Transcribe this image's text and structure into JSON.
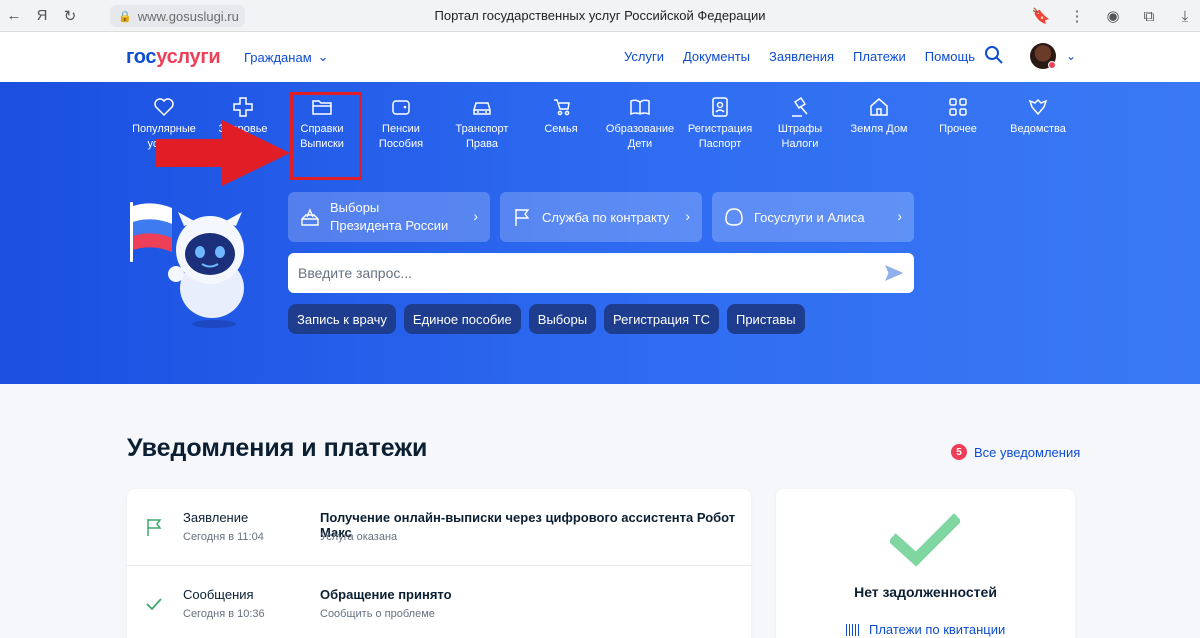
{
  "browser": {
    "url": "www.gosuslugi.ru",
    "tab_title": "Портал государственных услуг Российской Федерации"
  },
  "header": {
    "logo_part1": "гос",
    "logo_part2": "услуги",
    "audience_menu": "Гражданам",
    "nav": [
      "Услуги",
      "Документы",
      "Заявления",
      "Платежи",
      "Помощь"
    ]
  },
  "categories": [
    {
      "line1": "Популярные",
      "line2": "услуги",
      "icon": "heart-icon"
    },
    {
      "line1": "Здоровье",
      "line2": "",
      "icon": "plus-icon"
    },
    {
      "line1": "Справки",
      "line2": "Выписки",
      "icon": "folder-icon"
    },
    {
      "line1": "Пенсии",
      "line2": "Пособия",
      "icon": "wallet-icon"
    },
    {
      "line1": "Транспорт",
      "line2": "Права",
      "icon": "car-icon"
    },
    {
      "line1": "Семья",
      "line2": "",
      "icon": "stroller-icon"
    },
    {
      "line1": "Образование",
      "line2": "Дети",
      "icon": "book-icon"
    },
    {
      "line1": "Регистрация",
      "line2": "Паспорт",
      "icon": "passport-icon"
    },
    {
      "line1": "Штрафы",
      "line2": "Налоги",
      "icon": "gavel-icon"
    },
    {
      "line1": "Земля Дом",
      "line2": "",
      "icon": "house-icon"
    },
    {
      "line1": "Прочее",
      "line2": "",
      "icon": "grid-icon"
    },
    {
      "line1": "Ведомства",
      "line2": "",
      "icon": "emblem-icon"
    }
  ],
  "promos": [
    {
      "line1": "Выборы",
      "line2": "Президента России"
    },
    {
      "label": "Служба по контракту"
    },
    {
      "label": "Госуслуги и Алиса"
    }
  ],
  "search": {
    "placeholder": "Введите запрос..."
  },
  "chips": [
    "Запись к врачу",
    "Единое пособие",
    "Выборы",
    "Регистрация ТС",
    "Приставы"
  ],
  "notifications": {
    "title": "Уведомления и платежи",
    "all_link": "Все уведомления",
    "count": "5",
    "items": [
      {
        "type": "Заявление",
        "time": "Сегодня в 11:04",
        "title": "Получение онлайн-выписки через цифрового ассистента Робот Макс",
        "sub": "Услуга оказана"
      },
      {
        "type": "Сообщения",
        "time": "Сегодня в 10:36",
        "title": "Обращение принято",
        "sub": "Сообщить о проблеме"
      }
    ]
  },
  "debts": {
    "title": "Нет задолженностей",
    "receipts_link": "Платежи по квитанции"
  },
  "colors": {
    "brand_blue": "#0d4cd3",
    "brand_red": "#ee3f58",
    "highlight_red": "#e11d26",
    "success_green": "#7fd6a0"
  }
}
